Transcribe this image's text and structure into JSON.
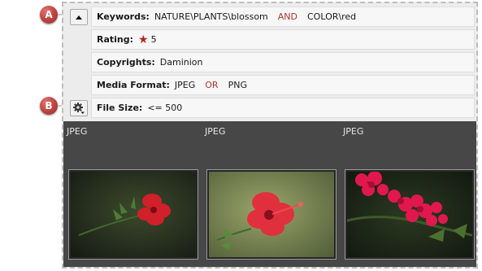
{
  "callouts": {
    "a": "A",
    "b": "B"
  },
  "filters": {
    "keywords": {
      "label": "Keywords:",
      "value1": "NATURE\\PLANTS\\blossom",
      "operator": "AND",
      "value2": "COLOR\\red"
    },
    "rating": {
      "label": "Rating:",
      "star_glyph": "★",
      "value": "5"
    },
    "copyrights": {
      "label": "Copyrights:",
      "value": "Daminion"
    },
    "media_format": {
      "label": "Media Format:",
      "value1": "JPEG",
      "operator": "OR",
      "value2": "PNG"
    },
    "file_size": {
      "label": "File Size:",
      "value": "<= 500"
    }
  },
  "thumbnails": [
    {
      "format": "JPEG",
      "subject": "red hibiscus flower on dark green background"
    },
    {
      "format": "JPEG",
      "subject": "red hibiscus flower on light green background"
    },
    {
      "format": "JPEG",
      "subject": "magenta bougainvillea blossoms"
    }
  ],
  "icons": {
    "collapse": "collapse-arrow-icon",
    "settings": "gear-dropdown-icon",
    "rating": "star-icon"
  },
  "colors": {
    "operator": "#a63a2e",
    "star": "#b3261e",
    "callout": "#c24a46",
    "gallery_bg": "#474747"
  }
}
